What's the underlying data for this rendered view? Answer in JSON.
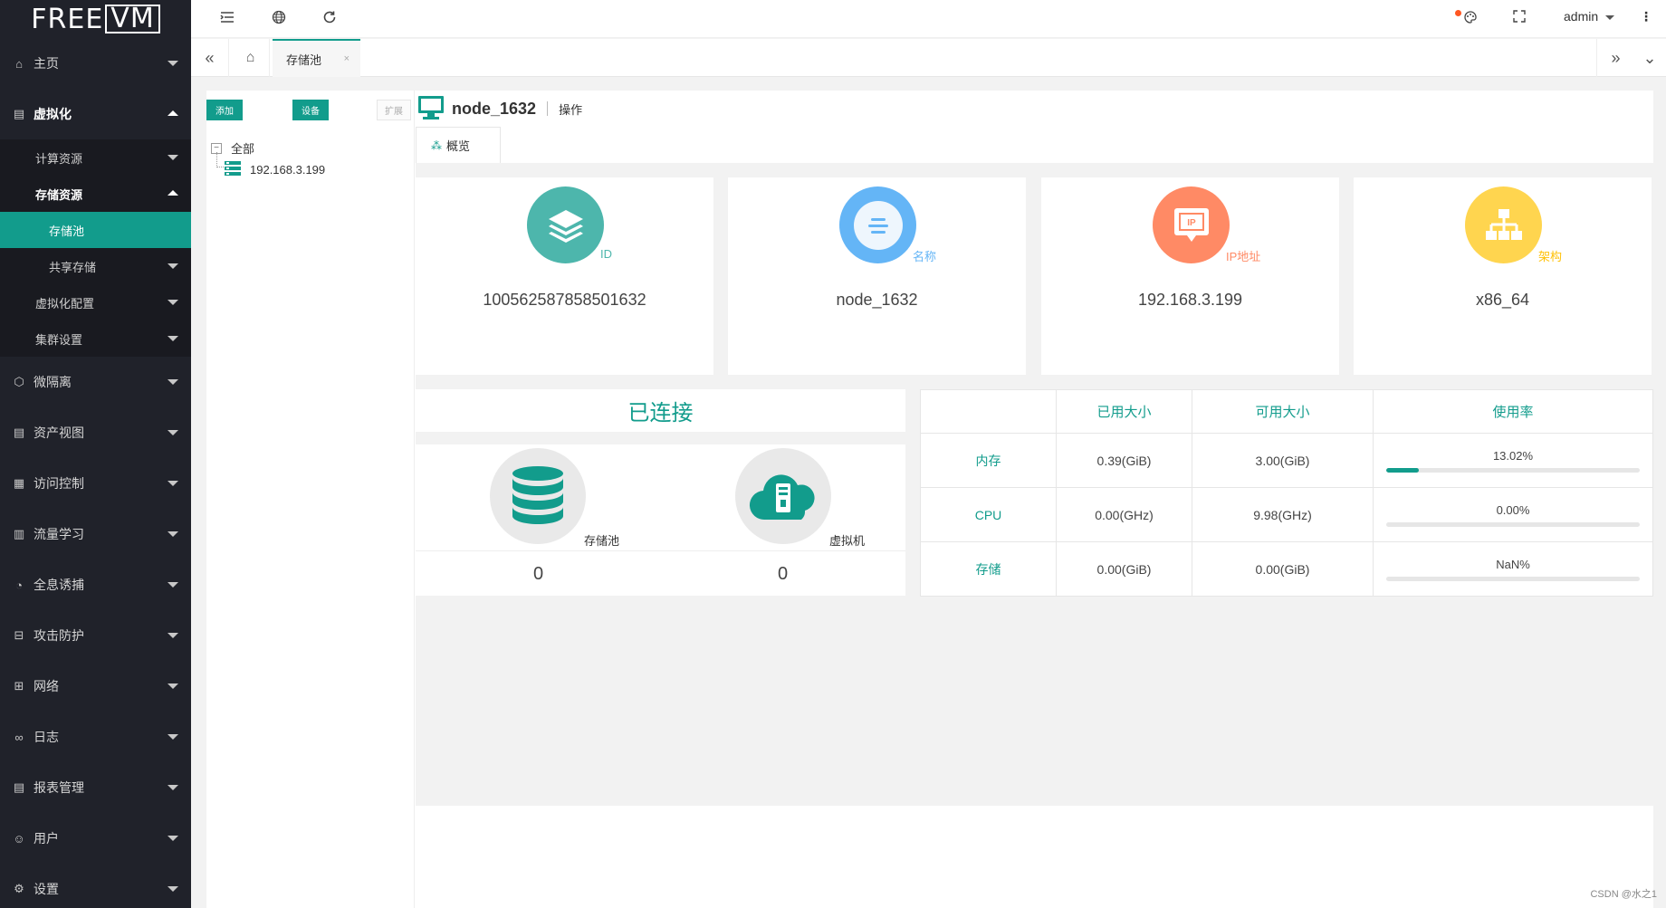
{
  "brand": {
    "logo_left": "FREE",
    "logo_right": "VM"
  },
  "sidebar": {
    "items": [
      {
        "label": "主页",
        "icon": "home-icon",
        "open": false
      },
      {
        "label": "虚拟化",
        "icon": "virtualization-icon",
        "open": true
      },
      {
        "label": "微隔离",
        "icon": "micro-isolation-icon",
        "open": false
      },
      {
        "label": "资产视图",
        "icon": "asset-view-icon",
        "open": false
      },
      {
        "label": "访问控制",
        "icon": "access-control-icon",
        "open": false
      },
      {
        "label": "流量学习",
        "icon": "traffic-learning-icon",
        "open": false
      },
      {
        "label": "全息诱捕",
        "icon": "honeypot-icon",
        "open": false
      },
      {
        "label": "攻击防护",
        "icon": "attack-protection-icon",
        "open": false
      },
      {
        "label": "网络",
        "icon": "network-icon",
        "open": false
      },
      {
        "label": "日志",
        "icon": "log-icon",
        "open": false
      },
      {
        "label": "报表管理",
        "icon": "report-icon",
        "open": false
      },
      {
        "label": "用户",
        "icon": "user-icon",
        "open": false
      },
      {
        "label": "设置",
        "icon": "settings-icon",
        "open": false
      }
    ],
    "virt_sub": [
      {
        "label": "计算资源"
      },
      {
        "label": "存储资源"
      },
      {
        "label": "虚拟化配置"
      },
      {
        "label": "集群设置"
      }
    ],
    "storage_sub": [
      {
        "label": "存储池",
        "active": true
      },
      {
        "label": "共享存储",
        "active": false
      }
    ]
  },
  "header": {
    "user": "admin"
  },
  "tabs": {
    "active_label": "存储池",
    "close": "×"
  },
  "tree": {
    "buttons": {
      "add": "添加",
      "device": "设备",
      "expand": "扩展"
    },
    "root_label": "全部",
    "toggle": "−",
    "node_label": "192.168.3.199"
  },
  "node": {
    "title": "node_1632",
    "operation": "操作",
    "overview_tab": "概览"
  },
  "cards": [
    {
      "label": "ID",
      "value": "100562587858501632",
      "color": "#4db6ac",
      "icon": "layers-icon"
    },
    {
      "label": "名称",
      "value": "node_1632",
      "color": "#64b5f6",
      "icon": "name-icon"
    },
    {
      "label": "IP地址",
      "value": "192.168.3.199",
      "color": "#ff8a65",
      "icon": "ip-icon"
    },
    {
      "label": "架构",
      "value": "x86_64",
      "color": "#ffd54f",
      "icon": "architecture-icon"
    }
  ],
  "connection": {
    "status": "已连接",
    "storage_pool_label": "存储池",
    "storage_pool_count": "0",
    "vm_label": "虚拟机",
    "vm_count": "0"
  },
  "stats": {
    "headers": [
      "",
      "已用大小",
      "可用大小",
      "使用率"
    ],
    "rows": [
      {
        "name": "内存",
        "used": "0.39(GiB)",
        "avail": "3.00(GiB)",
        "rate": "13.02%",
        "fraction": 0.1302
      },
      {
        "name": "CPU",
        "used": "0.00(GHz)",
        "avail": "9.98(GHz)",
        "rate": "0.00%",
        "fraction": 0
      },
      {
        "name": "存储",
        "used": "0.00(GiB)",
        "avail": "0.00(GiB)",
        "rate": "NaN%",
        "fraction": 0
      }
    ]
  },
  "watermark": "CSDN @水之1",
  "colors": {
    "accent": "#129c8c",
    "sidebar_bg": "#20222a"
  }
}
